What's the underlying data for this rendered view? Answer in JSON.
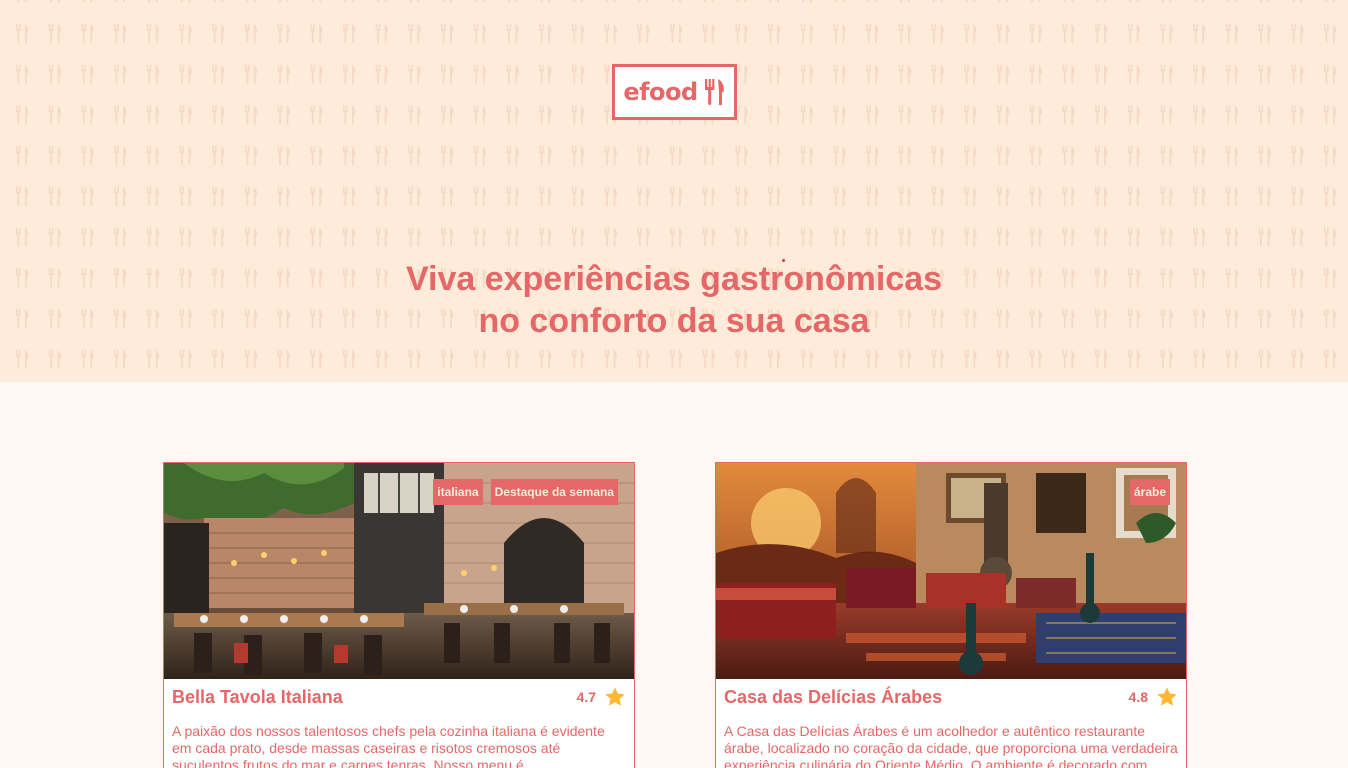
{
  "page": {
    "progress": 0.2
  },
  "header": {
    "logo_text": "efood",
    "headline_line1": "Viva experiências gastronômicas",
    "headline_line2": "no conforto da sua casa"
  },
  "colors": {
    "brand": "#E66767",
    "hero_bg": "#FFEBD9",
    "page_bg": "#FFF8F2",
    "star": "#FFB930"
  },
  "restaurants": [
    {
      "name": "Bella Tavola Italiana",
      "rating": "4.7",
      "tags": [
        "italiana",
        "Destaque da semana"
      ],
      "description": "A paixão dos nossos talentosos chefs pela cozinha italiana é evidente em cada prato, desde massas caseiras e risotos cremosos até suculentos frutos do mar e carnes tenras. Nosso menu é"
    },
    {
      "name": "Casa das Delícias Árabes",
      "rating": "4.8",
      "tags": [
        "árabe"
      ],
      "description": "A Casa das Delícias Árabes é um acolhedor e autêntico restaurante árabe, localizado no coração da cidade, que proporciona uma verdadeira experiência culinária do Oriente Médio. O ambiente é decorado com"
    }
  ],
  "icons": {
    "logo": "fork-knife-icon",
    "rating": "star-icon"
  }
}
